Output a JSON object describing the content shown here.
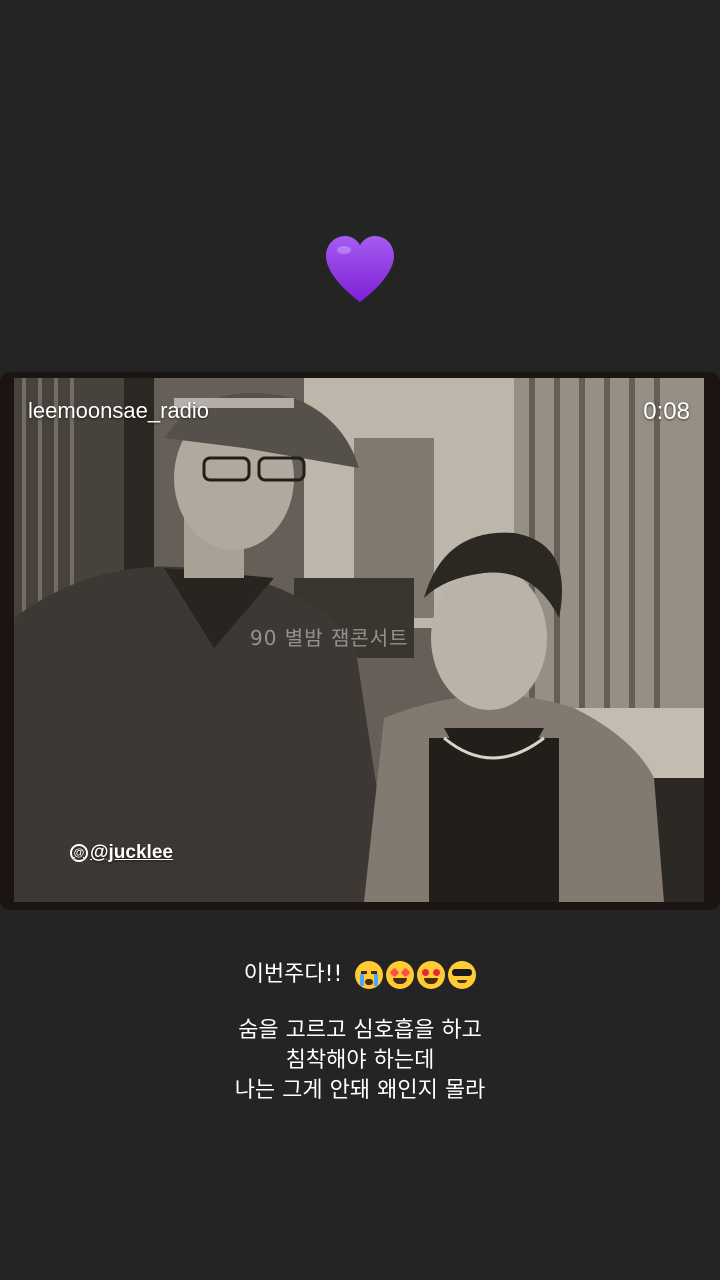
{
  "sticker": {
    "icon": "purple-heart-icon",
    "color": "#8a2be2"
  },
  "video": {
    "username": "leemoonsae_radio",
    "timestamp": "0:08",
    "caption_overlay": "90 별밤 잼콘서트",
    "tag_handle": "@jucklee"
  },
  "story_text": {
    "line1": "이번주다!!",
    "emojis": [
      "loudly-crying-face",
      "star-struck-face",
      "heart-eyes-face",
      "sunglasses-face"
    ],
    "lines": [
      "숨을 고르고 심호흡을 하고",
      "침착해야 하는데",
      "나는 그게 안돼  왜인지 몰라"
    ]
  }
}
